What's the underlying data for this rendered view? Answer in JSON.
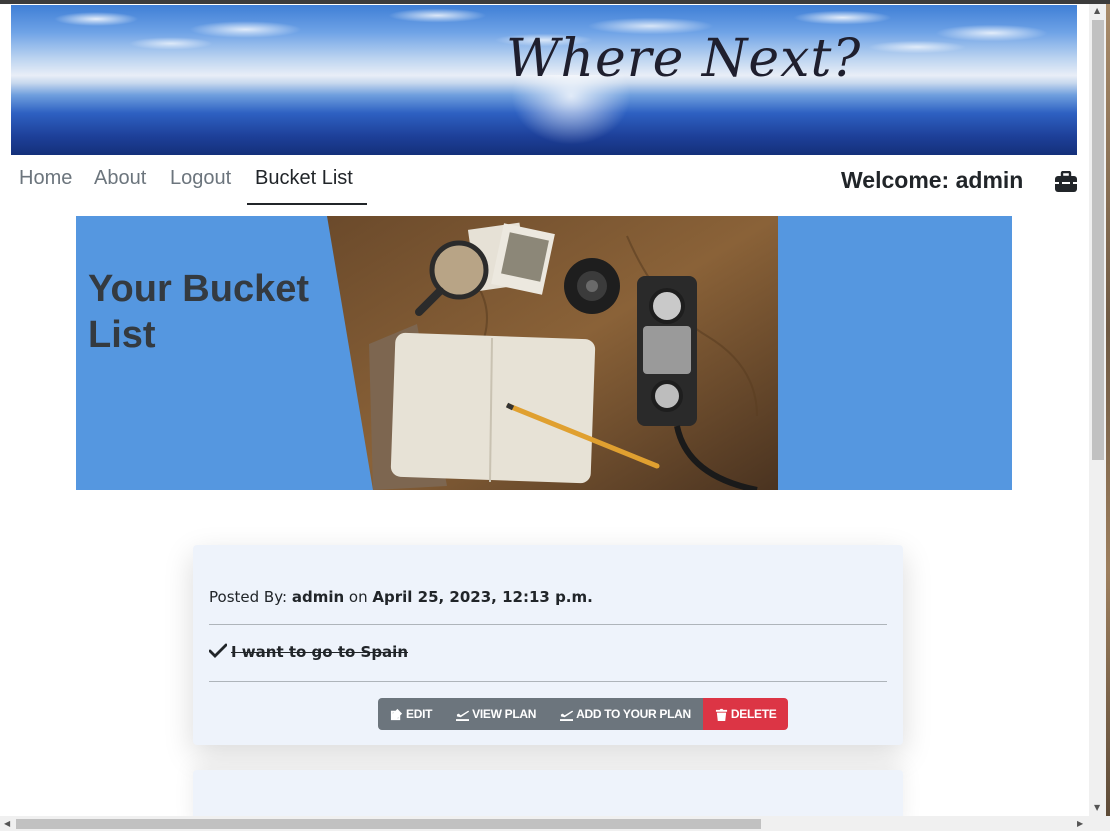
{
  "header": {
    "site_title": "Where Next?"
  },
  "nav": {
    "links": [
      {
        "label": "Home",
        "active": false
      },
      {
        "label": "About",
        "active": false
      },
      {
        "label": "Logout",
        "active": false
      },
      {
        "label": "Bucket List",
        "active": true
      }
    ],
    "welcome": "Welcome: admin",
    "icon": "toolbox-icon"
  },
  "hero": {
    "title": "Your Bucket List"
  },
  "entry": {
    "posted_by_label": "Posted By:",
    "author": "admin",
    "on_label": "on",
    "date": "April 25, 2023, 12:13 p.m.",
    "item_text": "I want to go to Spain",
    "completed": true,
    "buttons": {
      "edit": "EDIT",
      "view_plan": "VIEW PLAN",
      "add_to_plan": "ADD TO YOUR PLAN",
      "delete": "DELETE"
    }
  },
  "colors": {
    "hero_bg": "#5597e0",
    "card_bg": "#eef3fb",
    "button_gray": "#6c757d",
    "button_danger": "#dc3545"
  }
}
